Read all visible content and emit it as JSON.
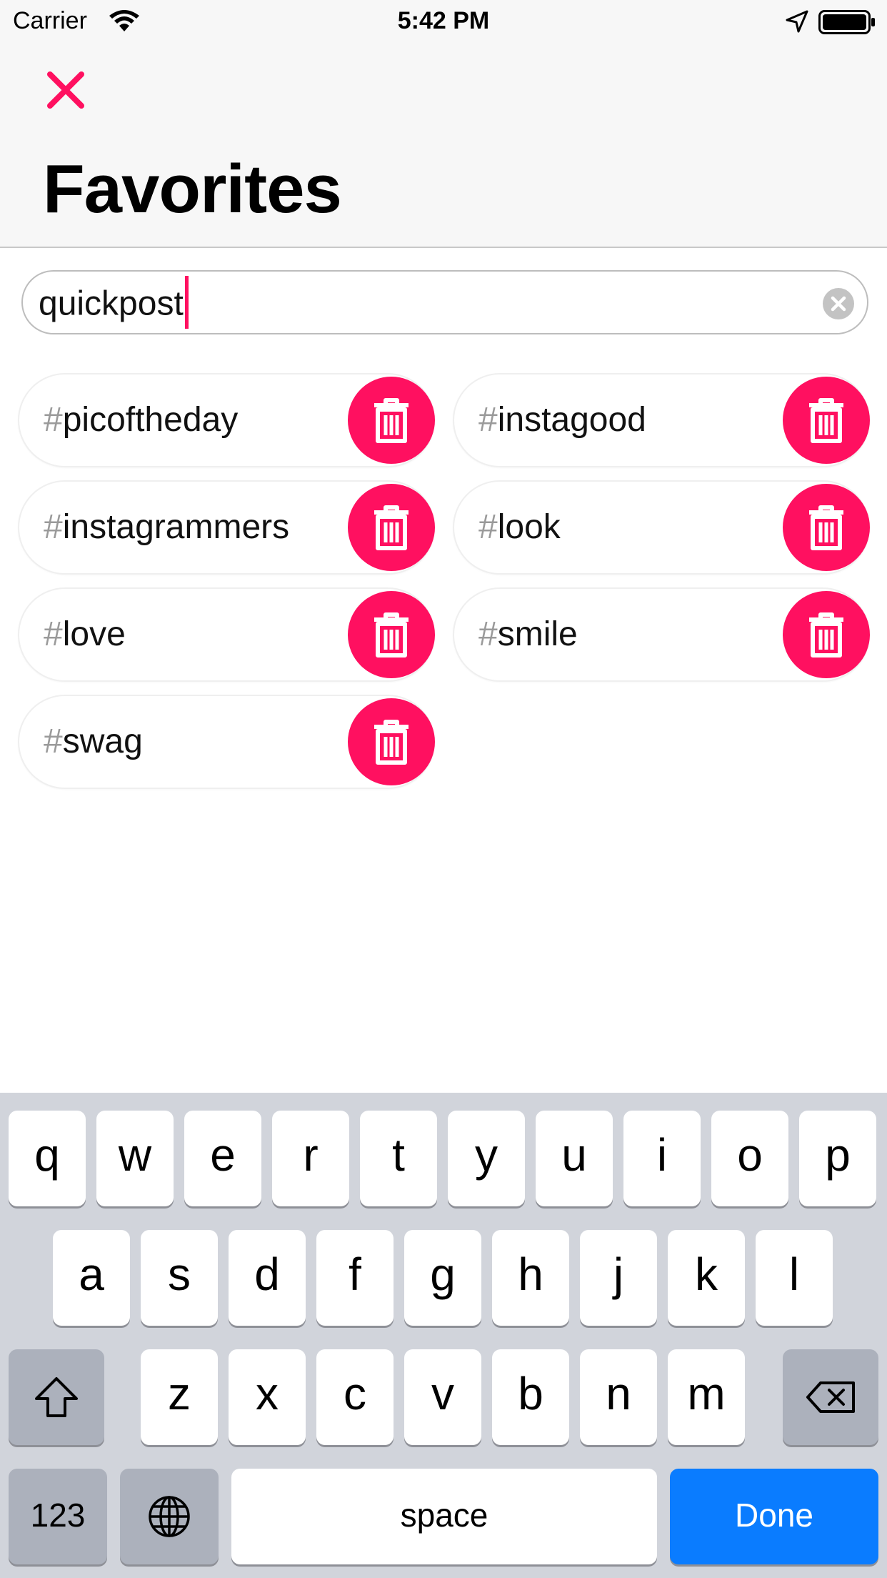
{
  "status_bar": {
    "carrier": "Carrier",
    "time": "5:42 PM"
  },
  "header": {
    "title": "Favorites"
  },
  "search": {
    "value": "quickpost"
  },
  "tags": [
    {
      "hash": "#",
      "name": "picoftheday"
    },
    {
      "hash": "#",
      "name": "instagood"
    },
    {
      "hash": "#",
      "name": "instagrammers"
    },
    {
      "hash": "#",
      "name": "look"
    },
    {
      "hash": "#",
      "name": "love"
    },
    {
      "hash": "#",
      "name": "smile"
    },
    {
      "hash": "#",
      "name": "swag"
    }
  ],
  "keyboard": {
    "row1": [
      "q",
      "w",
      "e",
      "r",
      "t",
      "y",
      "u",
      "i",
      "o",
      "p"
    ],
    "row2": [
      "a",
      "s",
      "d",
      "f",
      "g",
      "h",
      "j",
      "k",
      "l"
    ],
    "row3": [
      "z",
      "x",
      "c",
      "v",
      "b",
      "n",
      "m"
    ],
    "numbers_label": "123",
    "space_label": "space",
    "done_label": "Done"
  },
  "colors": {
    "accent": "#ff1060",
    "done_blue": "#0a7cff",
    "keyboard_bg": "#d1d4db"
  }
}
